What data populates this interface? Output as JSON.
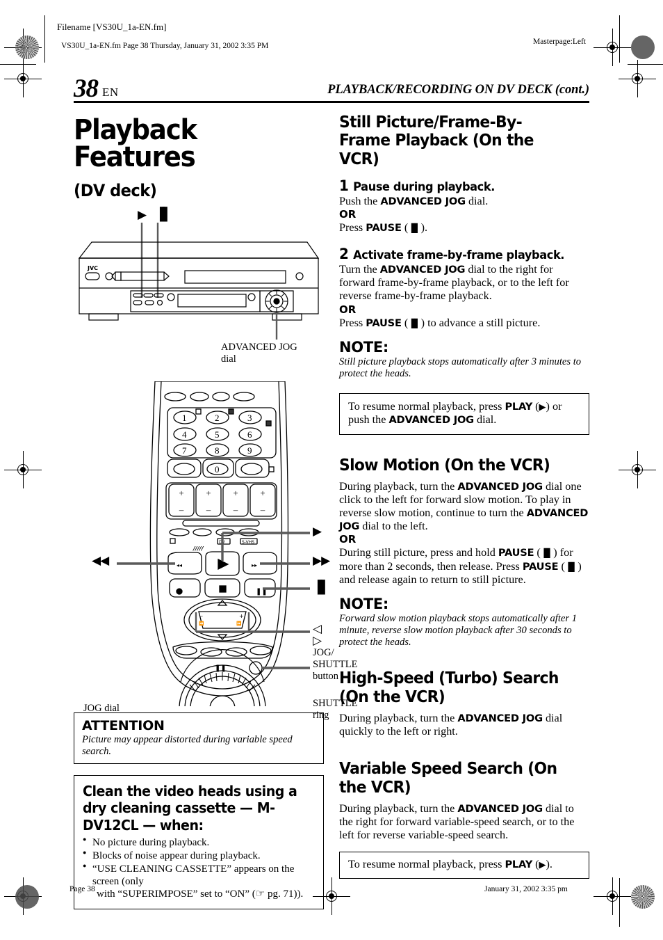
{
  "printer": {
    "filename_label": "Filename [VS30U_1a-EN.fm]",
    "fm_line": "VS30U_1a-EN.fm  Page 38  Thursday, January 31, 2002  3:35 PM",
    "masterpage": "Masterpage:Left",
    "footer_left": "Page 38",
    "footer_right": "January 31, 2002 3:35 pm"
  },
  "header": {
    "page_number": "38",
    "language_code": "EN",
    "running_head": "PLAYBACK/RECORDING ON DV DECK (cont.)"
  },
  "left_column": {
    "title": "Playback Features",
    "subtitle": "(DV deck)",
    "vcr_figure": {
      "brand": "JVC",
      "play_symbol": "▶",
      "pause_symbol": "▐▌",
      "callout": "ADVANCED JOG\ndial"
    },
    "remote_figure": {
      "keys": [
        "1",
        "2",
        "3",
        "4",
        "5",
        "6",
        "7",
        "8",
        "9",
        "0"
      ],
      "plus": "+",
      "minus": "–",
      "dv_label": "DV",
      "svhs_label": "S-VHS",
      "rew_symbol": "◀◀",
      "ff_symbol": "▶▶",
      "play_symbol": "▶",
      "pause_symbol": "▐▌",
      "arrows_symbol": "◁ ▷",
      "callout_jogshuttle": "JOG/\nSHUTTLE\nbutton",
      "callout_jogdial": "JOG dial",
      "callout_shuttlering": "SHUTTLE\nring"
    },
    "attention_box": {
      "title": "ATTENTION",
      "body": "Picture may appear distorted during variable speed search."
    },
    "cleaning_box": {
      "title": "Clean the video heads using a dry cleaning cassette — M-DV12CL — when:",
      "items": [
        "No picture during playback.",
        "Blocks of noise appear during playback."
      ],
      "item3_a": "“USE CLEANING CASSETTE” appears on the screen (only",
      "item3_b": "with “SUPERIMPOSE” set to “ON” (",
      "item3_ref": " pg. 71)).",
      "ref_icon": "☞"
    }
  },
  "right_column": {
    "section1": {
      "heading": "Still Picture/Frame-By-Frame Playback (On the VCR)",
      "step1": {
        "number": "1",
        "title": "Pause during playback.",
        "line1_a": "Push the ",
        "line1_b": "ADVANCED JOG",
        "line1_c": " dial.",
        "or": "OR",
        "line2_a": "Press ",
        "line2_b": "PAUSE",
        "line2_c": " (",
        "line2_sym": "▐▌",
        "line2_d": ")."
      },
      "step2": {
        "number": "2",
        "title": "Activate frame-by-frame playback.",
        "line1_a": "Turn the ",
        "line1_b": "ADVANCED JOG",
        "line1_c": " dial to the right for forward frame-by-frame playback, or to the left for reverse frame-by-frame playback.",
        "or": "OR",
        "line2_a": "Press ",
        "line2_b": "PAUSE",
        "line2_c": " (",
        "line2_sym": "▐▌",
        "line2_d": ") to advance a still picture."
      },
      "note_label": "NOTE:",
      "note_body": "Still picture playback stops automatically after 3 minutes to protect the heads.",
      "resume_box": {
        "a": "To resume normal playback, press ",
        "b": "PLAY",
        "c": " (",
        "sym": "▶",
        "d": ") or push the ",
        "e": "ADVANCED JOG",
        "f": " dial."
      }
    },
    "section2": {
      "heading": "Slow Motion (On the VCR)",
      "p1_a": "During playback, turn the ",
      "p1_b": "ADVANCED JOG",
      "p1_c": " dial one click to the left for forward slow motion. To play in reverse slow motion, continue to turn the ",
      "p1_d": "ADVANCED JOG",
      "p1_e": " dial to the left.",
      "or": "OR",
      "p2_a": "During still picture, press and hold ",
      "p2_b": "PAUSE",
      "p2_c": " (",
      "p2_sym": "▐▌",
      "p2_d": ") for more than 2 seconds, then release. Press ",
      "p2_e": "PAUSE",
      "p2_f": " (",
      "p2_sym2": "▐▌",
      "p2_g": ") and release again to return to still picture.",
      "note_label": "NOTE:",
      "note_body": "Forward slow motion playback stops automatically after 1 minute, reverse slow motion playback after 30 seconds to protect the heads."
    },
    "section3": {
      "heading": "High-Speed (Turbo) Search (On the VCR)",
      "p1_a": "During playback, turn the ",
      "p1_b": "ADVANCED JOG",
      "p1_c": " dial quickly to the left or right."
    },
    "section4": {
      "heading": "Variable Speed Search (On the VCR)",
      "p1_a": "During playback, turn the ",
      "p1_b": "ADVANCED JOG",
      "p1_c": " dial to the right for forward variable-speed search, or to the left for reverse variable-speed search.",
      "resume_box": {
        "a": "To resume normal playback, press ",
        "b": "PLAY",
        "c": " (",
        "sym": "▶",
        "d": ")."
      }
    }
  },
  "colors": {
    "ink": "#000000",
    "paper": "#ffffff",
    "leader": "#5a5a5a"
  }
}
